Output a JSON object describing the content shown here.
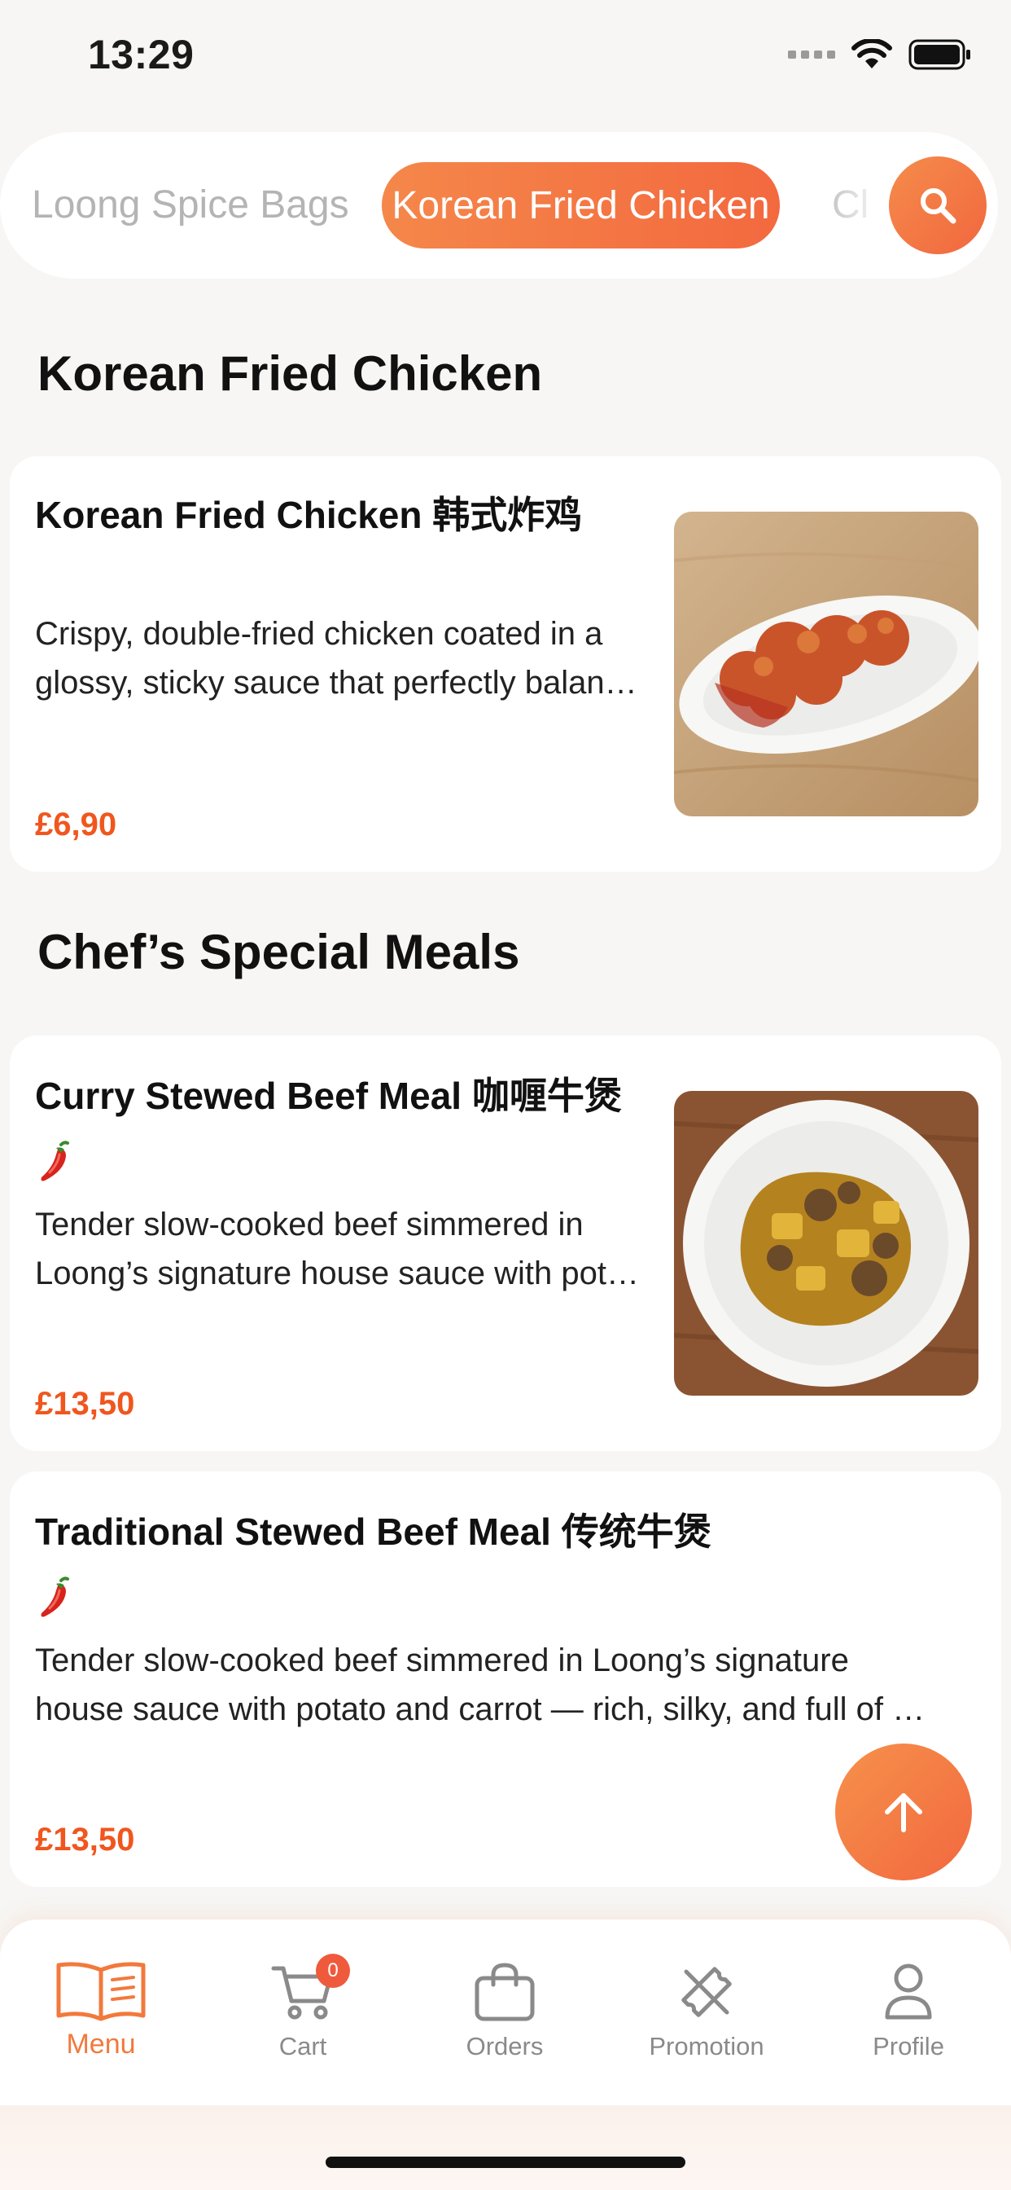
{
  "status": {
    "time": "13:29"
  },
  "categories": {
    "items": [
      "Loong Spice Bags",
      "Korean Fried Chicken",
      "Cl"
    ],
    "active": "Korean Fried Chicken"
  },
  "sections": [
    {
      "title": "Korean Fried Chicken",
      "items": [
        {
          "name": "Korean Fried Chicken 韩式炸鸡",
          "desc_line1": "Crispy, double-fried chicken coated in a",
          "desc_line2": "glossy, sticky sauce that perfectly balan…",
          "price": "£6,90",
          "image": "fried chicken on oval white plate"
        }
      ]
    },
    {
      "title": "Chef’s Special Meals",
      "items": [
        {
          "name": "Curry Stewed Beef Meal 咖喱牛煲",
          "spicy": true,
          "desc_line1": "Tender slow-cooked beef simmered in",
          "desc_line2": "Loong’s signature house sauce with pot…",
          "price": "£13,50",
          "image": "curry beef in white bowl"
        },
        {
          "name": "Traditional Stewed Beef Meal 传统牛煲",
          "spicy": true,
          "desc_line1": "Tender slow-cooked beef simmered in Loong’s signature",
          "desc_line2": "house sauce with potato and carrot  — rich, silky, and full of …",
          "price": "£13,50"
        }
      ]
    }
  ],
  "tabbar": {
    "items": [
      {
        "label": "Menu",
        "icon": "book-open-icon",
        "active": true
      },
      {
        "label": "Cart",
        "icon": "cart-icon",
        "badge": "0"
      },
      {
        "label": "Orders",
        "icon": "shopping-bag-icon"
      },
      {
        "label": "Promotion",
        "icon": "ticket-icon"
      },
      {
        "label": "Profile",
        "icon": "person-icon"
      }
    ]
  },
  "colors": {
    "accent": "#f3733f",
    "price": "#f0561e",
    "background": "#f7f6f4"
  }
}
